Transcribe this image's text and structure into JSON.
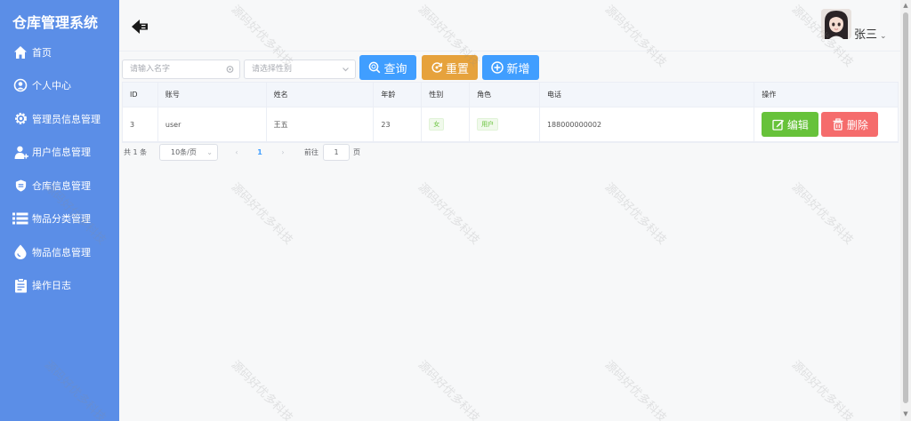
{
  "app": {
    "title": "仓库管理系统"
  },
  "sidebar": {
    "items": [
      {
        "label": "首页",
        "icon": "home-icon"
      },
      {
        "label": "个人中心",
        "icon": "user-center-icon"
      },
      {
        "label": "管理员信息管理",
        "icon": "gear-icon"
      },
      {
        "label": "用户信息管理",
        "icon": "add-user-icon"
      },
      {
        "label": "仓库信息管理",
        "icon": "shield-icon"
      },
      {
        "label": "物品分类管理",
        "icon": "list-icon"
      },
      {
        "label": "物品信息管理",
        "icon": "drop-icon"
      },
      {
        "label": "操作日志",
        "icon": "log-icon"
      }
    ]
  },
  "header": {
    "username": "张三",
    "chevron": "⌄"
  },
  "toolbar": {
    "name_placeholder": "请输入名字",
    "gender_placeholder": "请选择性别",
    "query_label": "查询",
    "reset_label": "重置",
    "add_label": "新增"
  },
  "table": {
    "columns": [
      "ID",
      "账号",
      "姓名",
      "年龄",
      "性别",
      "角色",
      "电话",
      "操作"
    ],
    "rows": [
      {
        "id": "3",
        "account": "user",
        "name": "王五",
        "age": "23",
        "gender": "女",
        "role": "用户",
        "phone": "188000000002",
        "edit_label": "编辑",
        "delete_label": "删除"
      }
    ]
  },
  "pagination": {
    "total": "共 1 条",
    "page_size": "10条/页",
    "prev": "‹",
    "current_page": "1",
    "next": "›",
    "goto_label": "前往",
    "goto_value": "1",
    "page_unit": "页"
  },
  "watermark": {
    "text": "源码好优多科技"
  },
  "colors": {
    "sidebar": "#5b8ee7",
    "primary": "#409eff",
    "warning": "#e6a23c",
    "success": "#67c23a",
    "danger": "#f56c6c"
  }
}
